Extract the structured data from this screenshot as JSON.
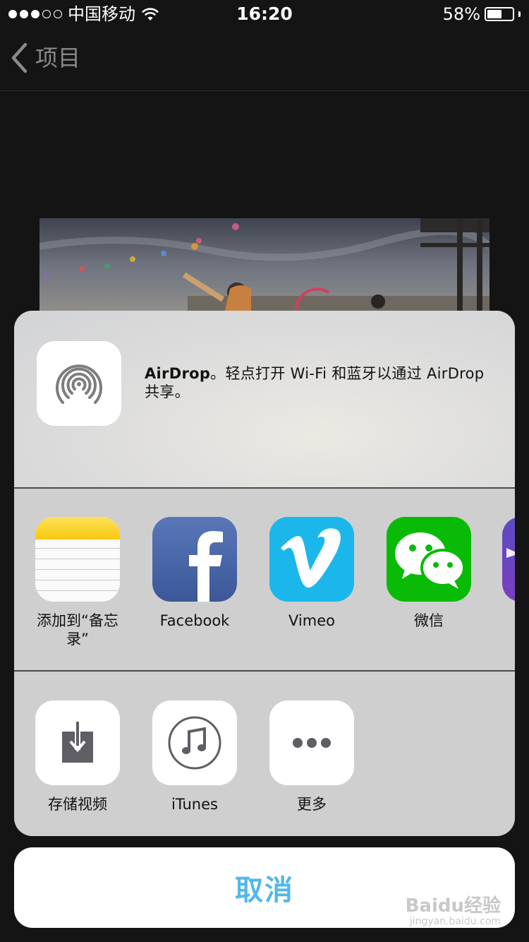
{
  "status_bar": {
    "carrier": "中国移动",
    "time": "16:20",
    "battery_percent": "58%",
    "battery_level": 0.58,
    "signal_bars_filled": 3,
    "signal_bars_total": 5
  },
  "nav": {
    "back_label": "项目",
    "back_icon": "chevron-left-icon"
  },
  "share_sheet": {
    "airdrop": {
      "icon": "airdrop-icon",
      "title": "AirDrop",
      "message": "。轻点打开 Wi-Fi 和蓝牙以通过 AirDrop 共享。"
    },
    "apps": [
      {
        "label": "添加到“备忘录”",
        "icon": "notes-icon"
      },
      {
        "label": "Facebook",
        "icon": "facebook-icon"
      },
      {
        "label": "Vimeo",
        "icon": "vimeo-icon"
      },
      {
        "label": "微信",
        "icon": "wechat-icon"
      },
      {
        "label": "",
        "icon": "partial-app-icon"
      }
    ],
    "actions": [
      {
        "label": "存储视频",
        "icon": "save-video-icon"
      },
      {
        "label": "iTunes",
        "icon": "itunes-icon"
      },
      {
        "label": "更多",
        "icon": "more-icon"
      }
    ]
  },
  "cancel_label": "取消",
  "watermark": {
    "logo": "Baidu经验",
    "url": "jingyan.baidu.com"
  },
  "colors": {
    "accent": "#52b8e8",
    "background": "#141414",
    "sheet": "#d3d3d3"
  }
}
